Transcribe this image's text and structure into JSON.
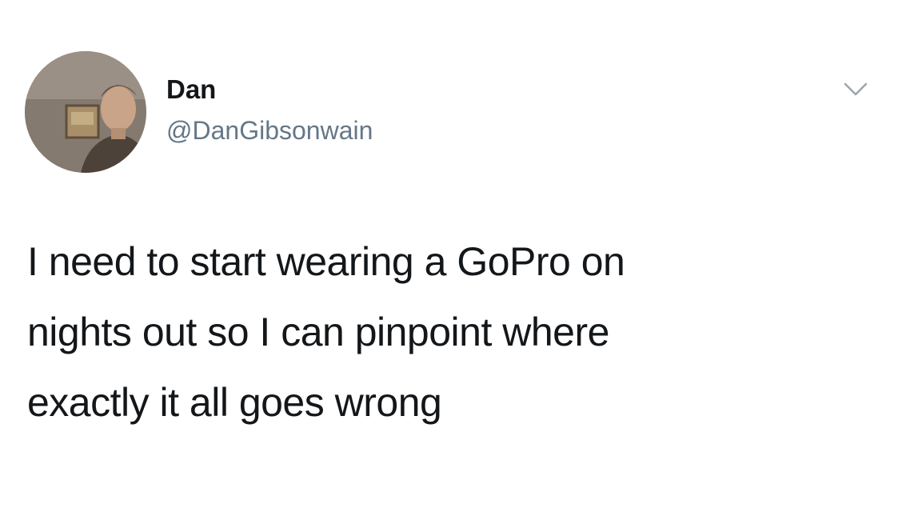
{
  "tweet": {
    "author": {
      "display_name": "Dan",
      "handle": "@DanGibsonwain"
    },
    "text_lines": [
      "I need to start wearing a GoPro on",
      "nights out so I can pinpoint where",
      "exactly it all goes wrong"
    ],
    "menu_icon": "chevron-down-icon"
  },
  "colors": {
    "text": "#14171a",
    "secondary_text": "#657786",
    "icon": "#9aa5ae",
    "background": "#ffffff"
  }
}
